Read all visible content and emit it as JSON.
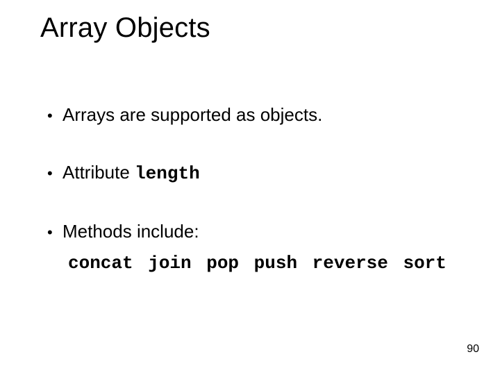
{
  "title": "Array Objects",
  "bullets": {
    "b1": "Arrays are supported as objects.",
    "b2_prefix": "Attribute ",
    "b2_code": "length",
    "b3": "Methods include:"
  },
  "methods_line": "concat join pop push reverse sort",
  "page_number": "90",
  "dot": "•"
}
